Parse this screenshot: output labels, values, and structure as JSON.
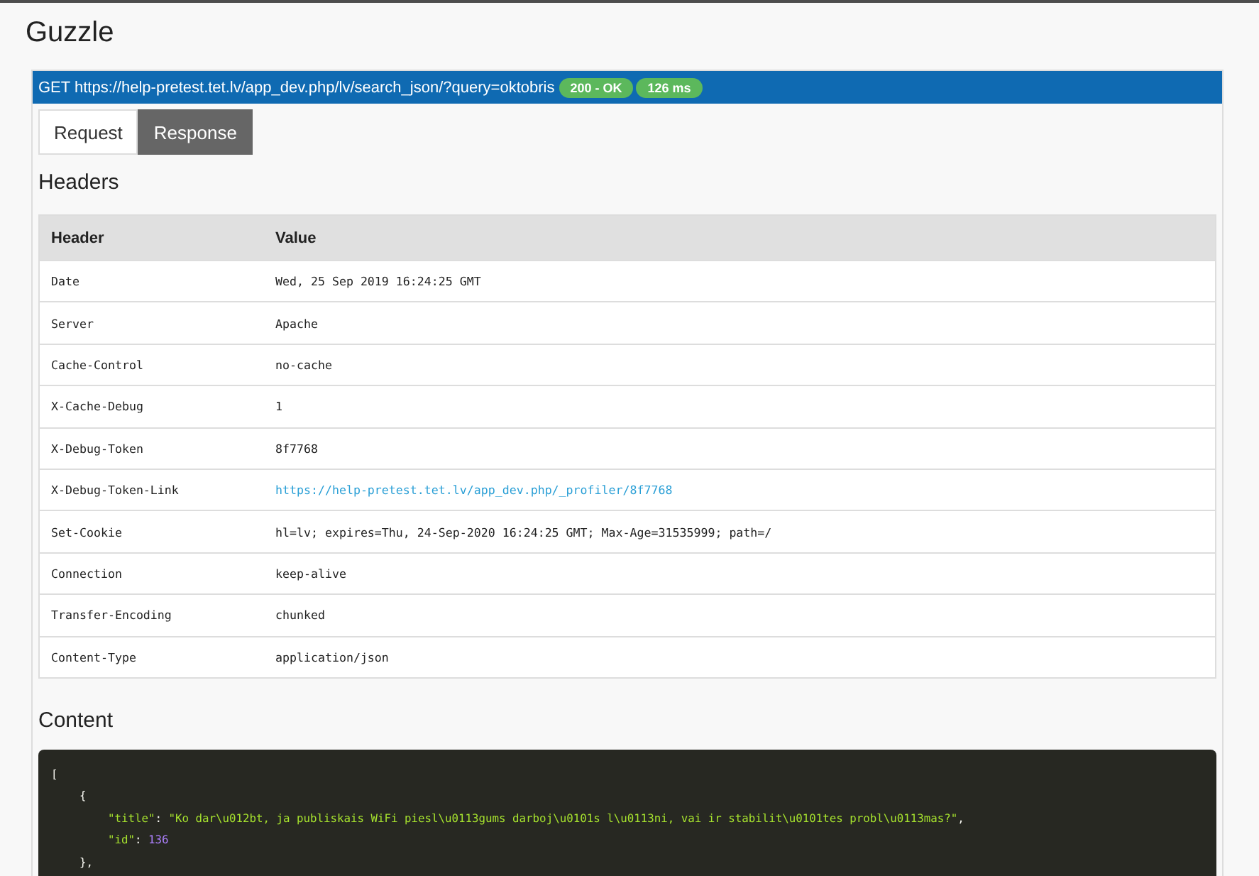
{
  "title": "Guzzle",
  "request": {
    "line": "GET https://help-pretest.tet.lv/app_dev.php/lv/search_json/?query=oktobris",
    "badges": [
      {
        "text": "200 - OK"
      },
      {
        "text": "126 ms"
      }
    ]
  },
  "tabs": [
    {
      "label": "Request",
      "selected": false
    },
    {
      "label": "Response",
      "selected": true
    }
  ],
  "headers": {
    "heading": "Headers",
    "table": {
      "columns": [
        "Header",
        "Value"
      ],
      "rows": [
        {
          "name": "Date",
          "value": "Wed, 25 Sep 2019 16:24:25 GMT",
          "kind": "text"
        },
        {
          "name": "Server",
          "value": "Apache",
          "kind": "text"
        },
        {
          "name": "Cache-Control",
          "value": "no-cache",
          "kind": "text"
        },
        {
          "name": "X-Cache-Debug",
          "value": "1",
          "kind": "text"
        },
        {
          "name": "X-Debug-Token",
          "value": "8f7768",
          "kind": "text"
        },
        {
          "name": "X-Debug-Token-Link",
          "value": "https://help-pretest.tet.lv/app_dev.php/_profiler/8f7768",
          "kind": "link"
        },
        {
          "name": "Set-Cookie",
          "value": "hl=lv; expires=Thu, 24-Sep-2020 16:24:25 GMT; Max-Age=31535999; path=/",
          "kind": "text"
        },
        {
          "name": "Connection",
          "value": "keep-alive",
          "kind": "text"
        },
        {
          "name": "Transfer-Encoding",
          "value": "chunked",
          "kind": "text"
        },
        {
          "name": "Content-Type",
          "value": "application/json",
          "kind": "text"
        }
      ]
    }
  },
  "content": {
    "heading": "Content",
    "code_lines": [
      {
        "tokens": [
          {
            "kind": "punct",
            "text": "["
          }
        ],
        "children": [
          {
            "tokens": [
              {
                "kind": "punct",
                "text": "{"
              }
            ],
            "children": [
              {
                "tokens": [
                  {
                    "kind": "key",
                    "text": "\"title\""
                  },
                  {
                    "kind": "punct",
                    "text": ": "
                  },
                  {
                    "kind": "string",
                    "text": "\"Ko dar\\u012bt, ja publiskais WiFi piesl\\u0113gums darboj\\u0101s l\\u0113ni, vai ir stabilit\\u0101tes probl\\u0113mas?\""
                  },
                  {
                    "kind": "punct",
                    "text": ","
                  }
                ]
              },
              {
                "tokens": [
                  {
                    "kind": "key",
                    "text": "\"id\""
                  },
                  {
                    "kind": "punct",
                    "text": ": "
                  },
                  {
                    "kind": "number",
                    "text": "136"
                  }
                ]
              }
            ]
          },
          {
            "tokens": [
              {
                "kind": "punct",
                "text": "},"
              }
            ]
          }
        ]
      }
    ]
  }
}
